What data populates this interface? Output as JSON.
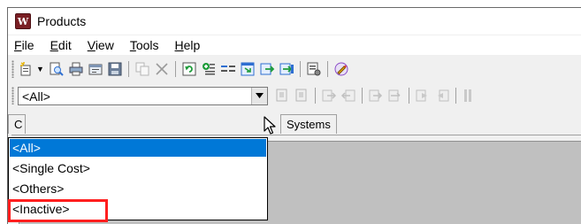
{
  "window": {
    "title": "Products",
    "app_icon_letter": "W"
  },
  "menu": {
    "file": {
      "key": "F",
      "rest": "ile"
    },
    "edit": {
      "key": "E",
      "rest": "dit"
    },
    "view": {
      "key": "V",
      "rest": "iew"
    },
    "tools": {
      "key": "T",
      "rest": "ools"
    },
    "help": {
      "key": "H",
      "rest": "elp"
    }
  },
  "toolbar1": {
    "icons": [
      "new-icon",
      "print-preview-icon",
      "print-icon",
      "properties-icon",
      "save-icon",
      "copy-icon",
      "delete-icon",
      "refresh-icon",
      "add-field-icon",
      "filter-icon",
      "import-icon",
      "export-icon",
      "export-all-icon",
      "settings-icon",
      "edit-pencil-icon"
    ]
  },
  "filter_combo": {
    "value": "<All>"
  },
  "filter_dropdown": {
    "options": [
      "<All>",
      "<Single Cost>",
      "<Others>",
      "<Inactive>"
    ],
    "selected_index": 0,
    "highlighted_option": "<Inactive>"
  },
  "tabs": {
    "first_partial": "C",
    "systems": "Systems"
  },
  "colors": {
    "selection": "#0078d7",
    "highlight_box": "#ff1e1e",
    "icon_green": "#1e9c3a",
    "icon_blue": "#2f6fd1",
    "icon_yellow": "#e8b400"
  }
}
